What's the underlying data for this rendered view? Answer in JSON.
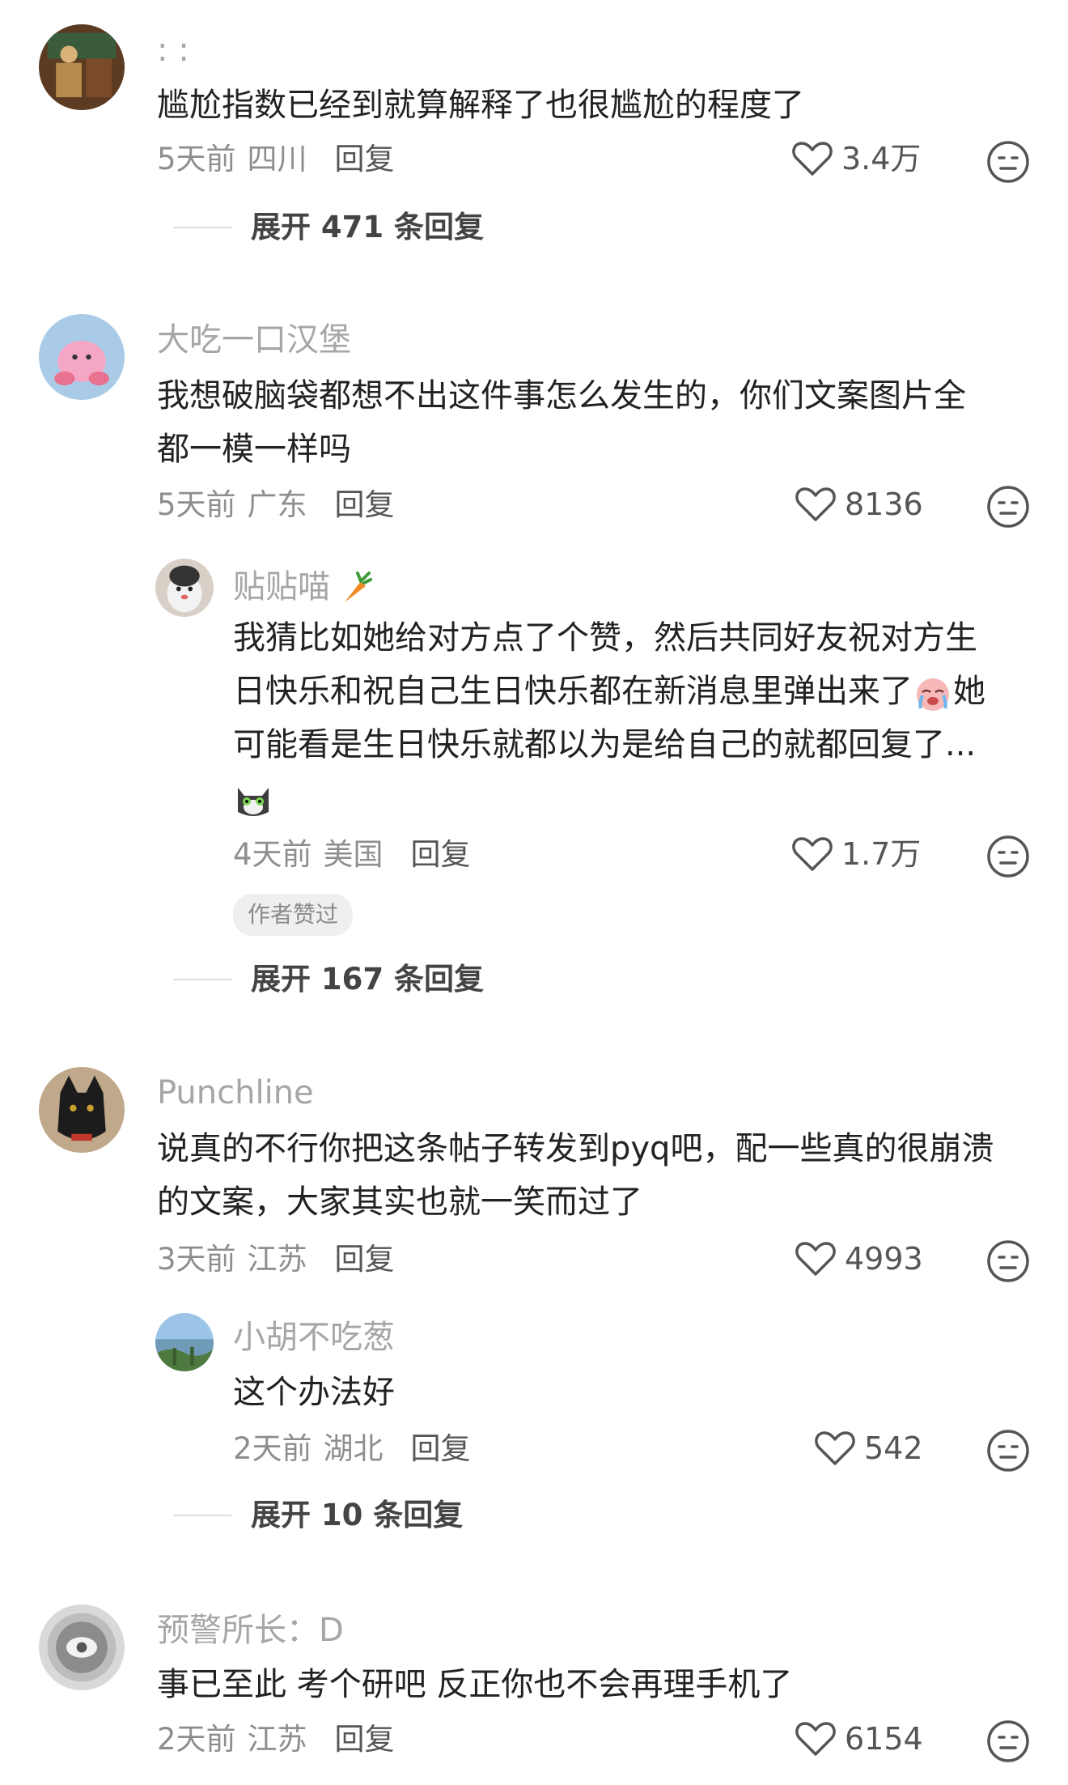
{
  "comments": [
    {
      "username": ": :",
      "text": "尴尬指数已经到就算解释了也很尴尬的程度了",
      "time": "5天前",
      "region": "四川",
      "reply_label": "回复",
      "likes": "3.4万",
      "expand": "展开 471 条回复"
    },
    {
      "username": "大吃一口汉堡",
      "text_line1": "我想破脑袋都想不出这件事怎么发生的，你们文案图片全",
      "text_line2": "都一模一样吗",
      "time": "5天前",
      "region": "广东",
      "reply_label": "回复",
      "likes": "8136",
      "reply": {
        "username": "贴贴喵",
        "username_emoji": "carrot-emoji",
        "text_line1": "我猜比如她给对方点了个赞，然后共同好友祝对方生",
        "text_line2": "日快乐和祝自己生日快乐都在新消息里弹出来了",
        "text_line2_emoji": "crying-face-emoji",
        "text_line2_tail": "她",
        "text_line3": "可能看是生日快乐就都以为是给自己的就都回复了...",
        "text_line4_emoji": "cat-face-emoji",
        "time": "4天前",
        "region": "美国",
        "reply_label": "回复",
        "likes": "1.7万",
        "badge": "作者赞过"
      },
      "expand": "展开 167 条回复"
    },
    {
      "username": "Punchline",
      "text_line1": "说真的不行你把这条帖子转发到pyq吧，配一些真的很崩溃",
      "text_line2": "的文案，大家其实也就一笑而过了",
      "time": "3天前",
      "region": "江苏",
      "reply_label": "回复",
      "likes": "4993",
      "reply": {
        "username": "小胡不吃葱",
        "text": "这个办法好",
        "time": "2天前",
        "region": "湖北",
        "reply_label": "回复",
        "likes": "542"
      },
      "expand": "展开 10 条回复"
    },
    {
      "username": "预警所长：D",
      "text": "事已至此 考个研吧 反正你也不会再理手机了",
      "time": "2天前",
      "region": "江苏",
      "reply_label": "回复",
      "likes": "6154"
    }
  ],
  "colors": {
    "text": "#222222",
    "username": "#a6a6a6",
    "meta": "#8e8e8e",
    "badge_bg": "#efefef"
  }
}
